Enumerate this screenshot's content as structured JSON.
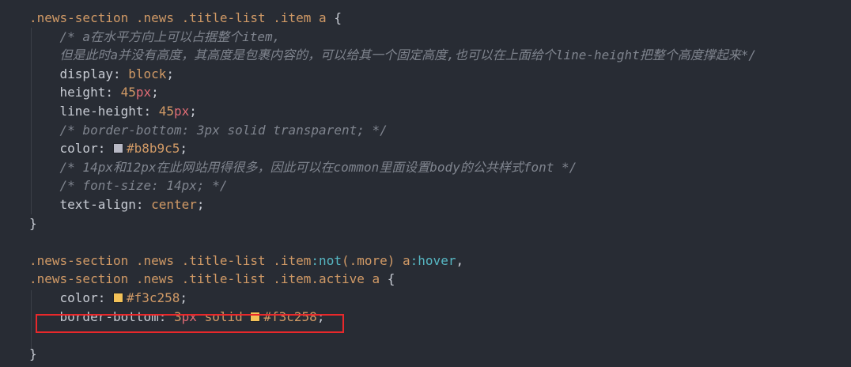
{
  "colors": {
    "background": "#282c34",
    "swatch_grey": "#b8b9c5",
    "swatch_yellow": "#f3c258",
    "annotation_box": "#e8282b"
  },
  "lines": [
    {
      "parts": [
        [
          ".news-section .news .title-list .item a",
          "sel"
        ],
        [
          " {",
          "punct"
        ]
      ]
    },
    {
      "parts": [
        [
          "    /* a在水平方向上可以占据整个item,",
          "comment"
        ]
      ]
    },
    {
      "parts": [
        [
          "    但是此时a并没有高度，其高度是包裹内容的，可以给其一个固定高度,也可以在上面给个line-height把整个高度撑起来*/",
          "comment"
        ]
      ]
    },
    {
      "parts": [
        [
          "    display",
          "prop"
        ],
        [
          ": ",
          "punct"
        ],
        [
          "block",
          "val"
        ],
        [
          ";",
          "punct"
        ]
      ]
    },
    {
      "parts": [
        [
          "    height",
          "prop"
        ],
        [
          ": ",
          "punct"
        ],
        [
          "45",
          "num"
        ],
        [
          "px",
          "unit"
        ],
        [
          ";",
          "punct"
        ]
      ]
    },
    {
      "parts": [
        [
          "    line-height",
          "prop"
        ],
        [
          ": ",
          "punct"
        ],
        [
          "45",
          "num"
        ],
        [
          "px",
          "unit"
        ],
        [
          ";",
          "punct"
        ]
      ]
    },
    {
      "parts": [
        [
          "    /* border-bottom: 3px solid transparent; */",
          "comment"
        ]
      ]
    },
    {
      "parts": [
        [
          "    color",
          "prop"
        ],
        [
          ": ",
          "punct"
        ],
        [
          "swatch:#b8b9c5",
          "swatch"
        ],
        [
          "#b8b9c5",
          "val"
        ],
        [
          ";",
          "punct"
        ]
      ]
    },
    {
      "parts": [
        [
          "    /* 14px和12px在此网站用得很多，因此可以在common里面设置body的公共样式font */",
          "comment"
        ]
      ]
    },
    {
      "parts": [
        [
          "    /* font-size: 14px; */",
          "comment"
        ]
      ]
    },
    {
      "parts": [
        [
          "    text-align",
          "prop"
        ],
        [
          ": ",
          "punct"
        ],
        [
          "center",
          "val"
        ],
        [
          ";",
          "punct"
        ]
      ]
    },
    {
      "parts": [
        [
          "}",
          "punct"
        ]
      ]
    },
    {
      "parts": []
    },
    {
      "parts": [
        [
          ".news-section .news .title-list .item",
          "sel"
        ],
        [
          ":not",
          "pseudo"
        ],
        [
          "(.more)",
          "sel"
        ],
        [
          " a",
          "sel"
        ],
        [
          ":hover",
          "pseudo"
        ],
        [
          ",",
          "punct"
        ]
      ]
    },
    {
      "parts": [
        [
          ".news-section .news .title-list .item.active a",
          "sel"
        ],
        [
          " {",
          "punct"
        ]
      ]
    },
    {
      "parts": [
        [
          "    color",
          "prop"
        ],
        [
          ": ",
          "punct"
        ],
        [
          "swatch:#f3c258",
          "swatch"
        ],
        [
          "#f3c258",
          "val"
        ],
        [
          ";",
          "punct"
        ]
      ]
    },
    {
      "parts": [
        [
          "    border-bottom",
          "prop"
        ],
        [
          ": ",
          "punct"
        ],
        [
          "3",
          "num"
        ],
        [
          "px",
          "unit"
        ],
        [
          " solid ",
          "val"
        ],
        [
          "swatch:#f3c258",
          "swatch"
        ],
        [
          "#f3c258",
          "val"
        ],
        [
          ";",
          "punct"
        ]
      ]
    },
    {
      "parts": []
    },
    {
      "parts": [
        [
          "}",
          "punct"
        ]
      ]
    }
  ]
}
